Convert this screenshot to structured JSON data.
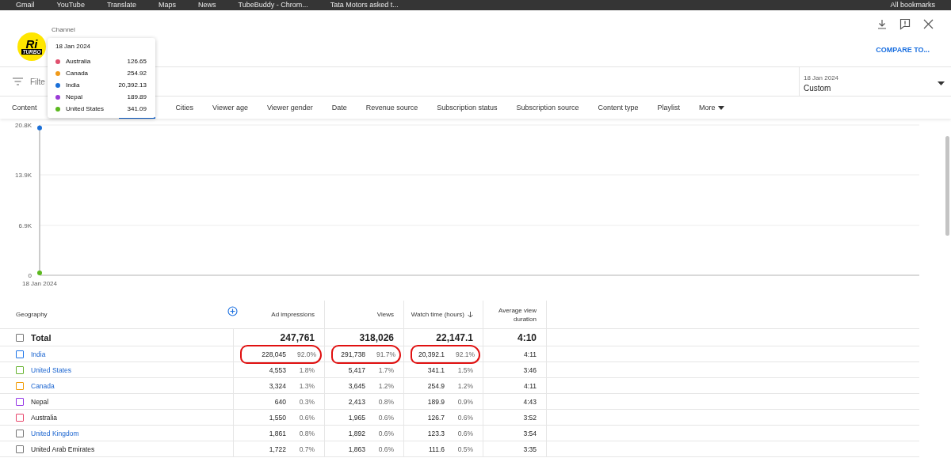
{
  "bookmarks": [
    "Gmail",
    "YouTube",
    "Translate",
    "Maps",
    "News",
    "TubeBuddy - Chrom...",
    "Tata Motors asked t...",
    "All bookmarks"
  ],
  "header": {
    "logo_text": "Ri",
    "logo_subtext": "TURBO",
    "channel_label": "Channel",
    "compare_link": "COMPARE TO..."
  },
  "filter": {
    "placeholder": "Filte",
    "date_range": {
      "label": "18 Jan 2024",
      "value": "Custom"
    }
  },
  "tabs": [
    {
      "label": "Content"
    },
    {
      "label": "Cities"
    },
    {
      "label": "Viewer age"
    },
    {
      "label": "Viewer gender"
    },
    {
      "label": "Date"
    },
    {
      "label": "Revenue source"
    },
    {
      "label": "Subscription status"
    },
    {
      "label": "Subscription source"
    },
    {
      "label": "Content type"
    },
    {
      "label": "Playlist"
    },
    {
      "label": "More",
      "dropdown": true
    }
  ],
  "tooltip": {
    "date": "18 Jan 2024",
    "values": [
      "126.65",
      "254.92",
      "20,392.13",
      "189.89",
      "341.09"
    ]
  },
  "chart": {
    "chart_data": {
      "type": "line",
      "categories": [
        "18 Jan 2024"
      ],
      "ylim": [
        0,
        20800
      ],
      "grid": true,
      "yticks": [
        {
          "value": 0,
          "label": "0"
        },
        {
          "value": 6900,
          "label": "6.9K"
        },
        {
          "value": 13900,
          "label": "13.9K"
        },
        {
          "value": 20800,
          "label": "20.8K"
        }
      ],
      "series": [
        {
          "name": "Australia",
          "color": "#e0506e",
          "marker": true,
          "values": [
            null
          ]
        },
        {
          "name": "Canada",
          "color": "#f09a1a",
          "marker": true,
          "values": [
            null
          ]
        },
        {
          "name": "India",
          "color": "#1a6fd8",
          "marker": true,
          "values": [
            20400
          ]
        },
        {
          "name": "Nepal",
          "color": "#9a3bd6",
          "marker": true,
          "values": [
            null
          ]
        },
        {
          "name": "United States",
          "color": "#5bb81e",
          "marker": true,
          "values": [
            340
          ]
        }
      ]
    }
  },
  "table": {
    "columns": [
      {
        "label": "Geography"
      },
      {
        "label": "Ad impressions"
      },
      {
        "label": "Views"
      },
      {
        "label": "Watch time (hours)",
        "sorted": true
      },
      {
        "label": "Average view duration"
      }
    ],
    "total": {
      "label": "Total",
      "checked": false,
      "ad_impressions": "247,761",
      "views": "318,026",
      "watch_time": "22,147.1",
      "avg_duration": "4:10"
    },
    "rows": [
      {
        "name": "India",
        "color": "#1a73e8",
        "checked": false,
        "linked": true,
        "annotated": true,
        "ad_impressions": "228,045",
        "ad_share": "92.0%",
        "views": "291,738",
        "views_share": "91.7%",
        "watch_time": "20,392.1",
        "watch_share": "92.1%",
        "avg_duration": "4:11"
      },
      {
        "name": "United States",
        "color": "#65b32e",
        "checked": false,
        "linked": true,
        "annotated": false,
        "ad_impressions": "4,553",
        "ad_share": "1.8%",
        "views": "5,417",
        "views_share": "1.7%",
        "watch_time": "341.1",
        "watch_share": "1.5%",
        "avg_duration": "3:46"
      },
      {
        "name": "Canada",
        "color": "#f29900",
        "checked": false,
        "linked": true,
        "annotated": false,
        "ad_impressions": "3,324",
        "ad_share": "1.3%",
        "views": "3,645",
        "views_share": "1.2%",
        "watch_time": "254.9",
        "watch_share": "1.2%",
        "avg_duration": "4:11"
      },
      {
        "name": "Nepal",
        "color": "#9334e6",
        "checked": false,
        "linked": false,
        "annotated": false,
        "ad_impressions": "640",
        "ad_share": "0.3%",
        "views": "2,413",
        "views_share": "0.8%",
        "watch_time": "189.9",
        "watch_share": "0.9%",
        "avg_duration": "4:43"
      },
      {
        "name": "Australia",
        "color": "#e8446a",
        "checked": false,
        "linked": false,
        "annotated": false,
        "ad_impressions": "1,550",
        "ad_share": "0.6%",
        "views": "1,965",
        "views_share": "0.6%",
        "watch_time": "126.7",
        "watch_share": "0.6%",
        "avg_duration": "3:52"
      },
      {
        "name": "United Kingdom",
        "color": "#757575",
        "checked": false,
        "linked": true,
        "annotated": false,
        "ad_impressions": "1,861",
        "ad_share": "0.8%",
        "views": "1,892",
        "views_share": "0.6%",
        "watch_time": "123.3",
        "watch_share": "0.6%",
        "avg_duration": "3:54"
      },
      {
        "name": "United Arab Emirates",
        "color": "#757575",
        "checked": false,
        "linked": false,
        "annotated": false,
        "ad_impressions": "1,722",
        "ad_share": "0.7%",
        "views": "1,863",
        "views_share": "0.6%",
        "watch_time": "111.6",
        "watch_share": "0.5%",
        "avg_duration": "3:35"
      }
    ]
  }
}
